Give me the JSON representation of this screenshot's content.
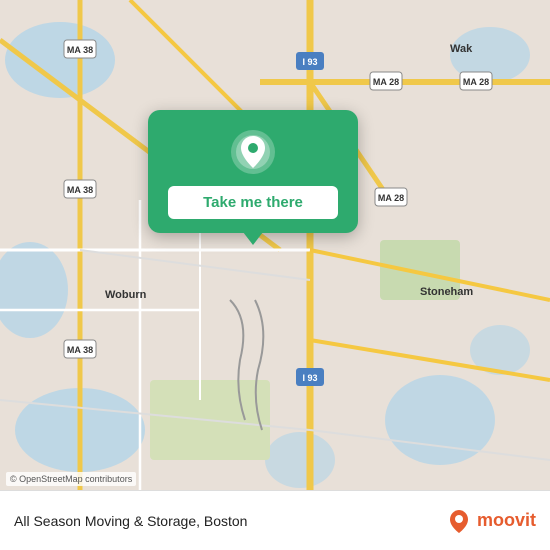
{
  "map": {
    "credit": "© OpenStreetMap contributors",
    "accent_color": "#2eaa6e",
    "bg_color": "#e8e0d8",
    "water_color": "#b3d4e8",
    "road_color": "#f5c842",
    "road_minor_color": "#ffffff",
    "highway_color": "#c8b04a"
  },
  "popup": {
    "button_label": "Take me there",
    "pin_icon": "location-pin"
  },
  "footer": {
    "title": "All Season Moving & Storage, Boston",
    "logo_text": "moovit"
  }
}
